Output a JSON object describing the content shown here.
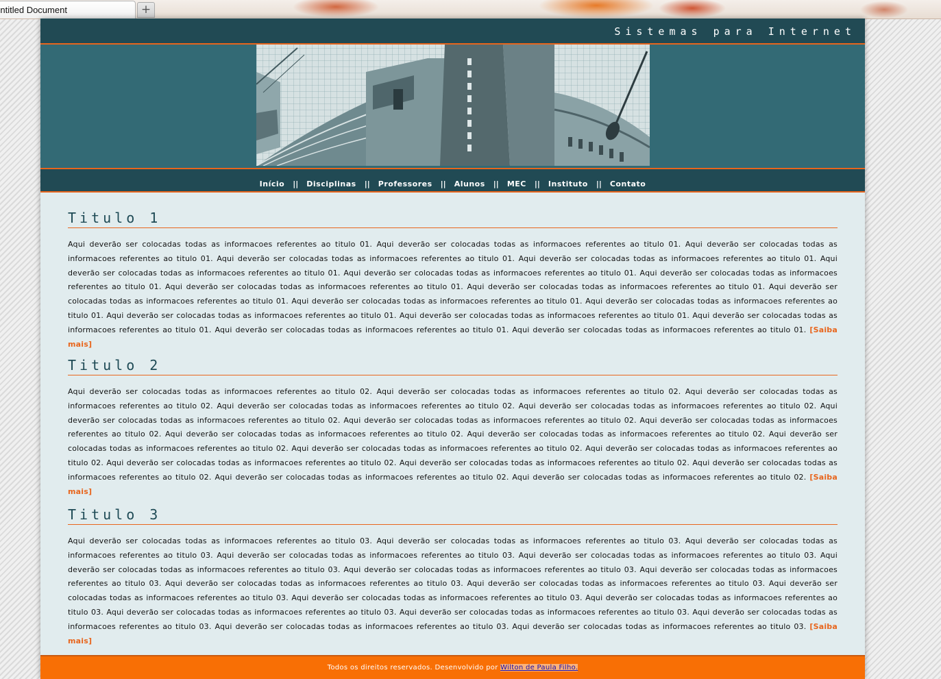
{
  "browser": {
    "tab_title": "Untitled Document",
    "new_tab_label": "+"
  },
  "header": {
    "site_title": "Sistemas para Internet"
  },
  "nav": {
    "items": [
      "Início",
      "Disciplinas",
      "Professores",
      "Alunos",
      "MEC",
      "Instituto",
      "Contato"
    ],
    "separator": "||"
  },
  "sections": [
    {
      "title": "Titulo 1",
      "text": "Aqui deverão ser colocadas todas as informacoes referentes ao titulo 01. Aqui deverão ser colocadas todas as informacoes referentes ao titulo 01. Aqui deverão ser colocadas todas as informacoes referentes ao titulo 01. Aqui deverão ser colocadas todas as informacoes referentes ao titulo 01. Aqui deverão ser colocadas todas as informacoes referentes ao titulo 01. Aqui deverão ser colocadas todas as informacoes referentes ao titulo 01. Aqui deverão ser colocadas todas as informacoes referentes ao titulo 01. Aqui deverão ser colocadas todas as informacoes referentes ao titulo 01. Aqui deverão ser colocadas todas as informacoes referentes ao titulo 01. Aqui deverão ser colocadas todas as informacoes referentes ao titulo 01. Aqui deverão ser colocadas todas as informacoes referentes ao titulo 01. Aqui deverão ser colocadas todas as informacoes referentes ao titulo 01. Aqui deverão ser colocadas todas as informacoes referentes ao titulo 01. Aqui deverão ser colocadas todas as informacoes referentes ao titulo 01. Aqui deverão ser colocadas todas as informacoes referentes ao titulo 01. Aqui deverão ser colocadas todas as informacoes referentes ao titulo 01. Aqui deverão ser colocadas todas as informacoes referentes ao titulo 01. Aqui deverão ser colocadas todas as informacoes referentes ao titulo 01. ",
      "more": "[Saiba mais]"
    },
    {
      "title": "Titulo 2",
      "text": "Aqui deverão ser colocadas todas as informacoes referentes ao titulo 02. Aqui deverão ser colocadas todas as informacoes referentes ao titulo 02. Aqui deverão ser colocadas todas as informacoes referentes ao titulo 02. Aqui deverão ser colocadas todas as informacoes referentes ao titulo 02. Aqui deverão ser colocadas todas as informacoes referentes ao titulo 02. Aqui deverão ser colocadas todas as informacoes referentes ao titulo 02. Aqui deverão ser colocadas todas as informacoes referentes ao titulo 02. Aqui deverão ser colocadas todas as informacoes referentes ao titulo 02. Aqui deverão ser colocadas todas as informacoes referentes ao titulo 02. Aqui deverão ser colocadas todas as informacoes referentes ao titulo 02. Aqui deverão ser colocadas todas as informacoes referentes ao titulo 02. Aqui deverão ser colocadas todas as informacoes referentes ao titulo 02. Aqui deverão ser colocadas todas as informacoes referentes ao titulo 02. Aqui deverão ser colocadas todas as informacoes referentes ao titulo 02. Aqui deverão ser colocadas todas as informacoes referentes ao titulo 02. Aqui deverão ser colocadas todas as informacoes referentes ao titulo 02. Aqui deverão ser colocadas todas as informacoes referentes ao titulo 02. Aqui deverão ser colocadas todas as informacoes referentes ao titulo 02. ",
      "more": "[Saiba mais]"
    },
    {
      "title": "Titulo 3",
      "text": "Aqui deverão ser colocadas todas as informacoes referentes ao titulo 03. Aqui deverão ser colocadas todas as informacoes referentes ao titulo 03. Aqui deverão ser colocadas todas as informacoes referentes ao titulo 03. Aqui deverão ser colocadas todas as informacoes referentes ao titulo 03. Aqui deverão ser colocadas todas as informacoes referentes ao titulo 03. Aqui deverão ser colocadas todas as informacoes referentes ao titulo 03. Aqui deverão ser colocadas todas as informacoes referentes ao titulo 03. Aqui deverão ser colocadas todas as informacoes referentes ao titulo 03. Aqui deverão ser colocadas todas as informacoes referentes ao titulo 03. Aqui deverão ser colocadas todas as informacoes referentes ao titulo 03. Aqui deverão ser colocadas todas as informacoes referentes ao titulo 03. Aqui deverão ser colocadas todas as informacoes referentes ao titulo 03. Aqui deverão ser colocadas todas as informacoes referentes ao titulo 03. Aqui deverão ser colocadas todas as informacoes referentes ao titulo 03. Aqui deverão ser colocadas todas as informacoes referentes ao titulo 03. Aqui deverão ser colocadas todas as informacoes referentes ao titulo 03. Aqui deverão ser colocadas todas as informacoes referentes ao titulo 03. Aqui deverão ser colocadas todas as informacoes referentes ao titulo 03. ",
      "more": "[Saiba mais]"
    }
  ],
  "footer": {
    "text": "Todos os direitos reservados. Desenvolvido por ",
    "author_link": "Wilton de Paula Filho."
  },
  "colors": {
    "header_bg": "#214a54",
    "banner_bg": "#336a75",
    "accent": "#e8651c",
    "content_bg": "#e1ecee",
    "footer_bg": "#f86f05",
    "title_text": "#1e4a55"
  },
  "banner": {
    "image": "building-photo"
  }
}
